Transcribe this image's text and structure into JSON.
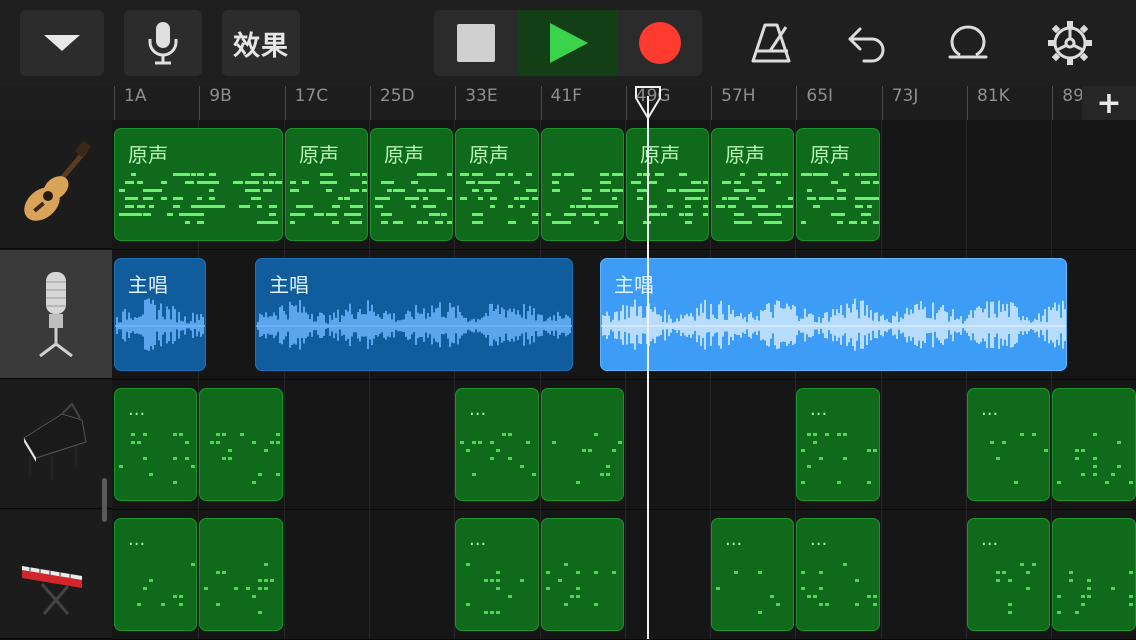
{
  "toolbar": {
    "fx_label": "效果",
    "accent": {
      "play": "#3ad34b",
      "record": "#ff3b30"
    }
  },
  "ruler": {
    "markers": [
      "1A",
      "9B",
      "17C",
      "25D",
      "33E",
      "41F",
      "49G",
      "57H",
      "65I",
      "73J",
      "81K",
      "89"
    ],
    "add_label": "+"
  },
  "tracks": [
    {
      "instrument": "acoustic-guitar",
      "regions": [
        {
          "label": "原声",
          "start": 0,
          "end": 2
        },
        {
          "label": "原声",
          "start": 2,
          "end": 3
        },
        {
          "label": "原声",
          "start": 3,
          "end": 4
        },
        {
          "label": "原声",
          "start": 4,
          "end": 5
        },
        {
          "label": "",
          "start": 5,
          "end": 6
        },
        {
          "label": "原声",
          "start": 6,
          "end": 7
        },
        {
          "label": "原声",
          "start": 7,
          "end": 8
        },
        {
          "label": "原声",
          "start": 8,
          "end": 9
        }
      ]
    },
    {
      "instrument": "microphone",
      "regions": [
        {
          "label": "主唱",
          "start": 0,
          "end": 1.1
        },
        {
          "label": "主唱",
          "start": 1.65,
          "end": 5.4
        },
        {
          "label": "主唱",
          "start": 5.7,
          "end": 11.2
        }
      ]
    },
    {
      "instrument": "grand-piano",
      "regions": [
        {
          "label": "...",
          "start": 0,
          "end": 1
        },
        {
          "label": "",
          "start": 1,
          "end": 2
        },
        {
          "label": "...",
          "start": 4,
          "end": 5
        },
        {
          "label": "",
          "start": 5,
          "end": 6
        },
        {
          "label": "...",
          "start": 8,
          "end": 9
        },
        {
          "label": "...",
          "start": 10,
          "end": 11
        },
        {
          "label": "",
          "start": 11,
          "end": 12
        }
      ]
    },
    {
      "instrument": "keyboard",
      "regions": [
        {
          "label": "...",
          "start": 0,
          "end": 1
        },
        {
          "label": "",
          "start": 1,
          "end": 2
        },
        {
          "label": "...",
          "start": 4,
          "end": 5
        },
        {
          "label": "",
          "start": 5,
          "end": 6
        },
        {
          "label": "...",
          "start": 7,
          "end": 8
        },
        {
          "label": "...",
          "start": 8,
          "end": 9
        },
        {
          "label": "...",
          "start": 10,
          "end": 11
        },
        {
          "label": "",
          "start": 11,
          "end": 12
        }
      ]
    }
  ],
  "playhead_bar": 49
}
